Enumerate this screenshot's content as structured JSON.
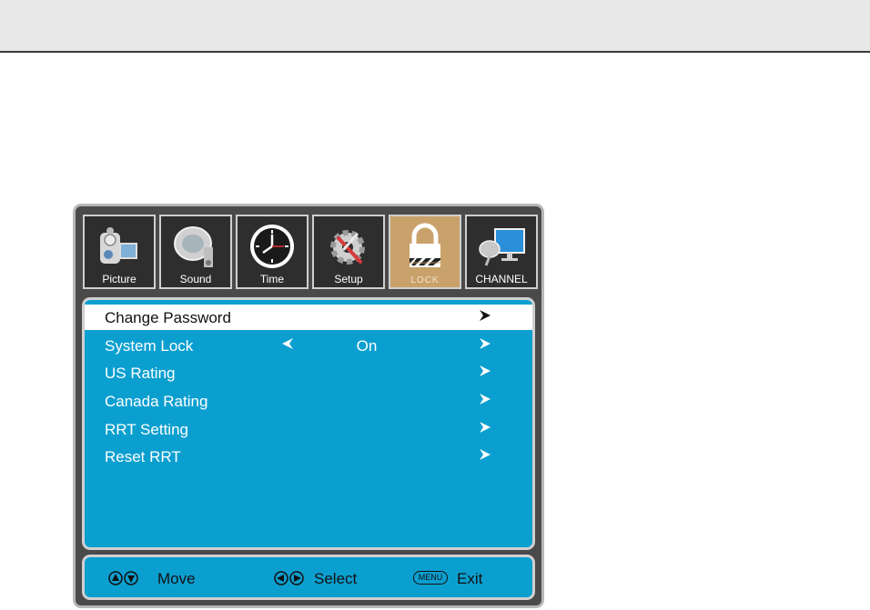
{
  "tabs": [
    {
      "label": "Picture",
      "icon": "camcorder-icon"
    },
    {
      "label": "Sound",
      "icon": "speaker-icon"
    },
    {
      "label": "Time",
      "icon": "clock-icon"
    },
    {
      "label": "Setup",
      "icon": "gear-wrench-icon"
    },
    {
      "label": "LOCK",
      "icon": "padlock-icon",
      "active": true
    },
    {
      "label": "CHANNEL",
      "icon": "satellite-monitor-icon"
    }
  ],
  "menu": {
    "items": [
      {
        "label": "Change Password",
        "value": "",
        "selected": true
      },
      {
        "label": "System Lock",
        "value": "On"
      },
      {
        "label": "US Rating",
        "value": ""
      },
      {
        "label": "Canada Rating",
        "value": ""
      },
      {
        "label": "RRT Setting",
        "value": ""
      },
      {
        "label": "Reset RRT",
        "value": ""
      }
    ]
  },
  "hints": {
    "move": "Move",
    "select": "Select",
    "menu_key": "MENU",
    "exit": "Exit"
  },
  "colors": {
    "panel": "#0b9fd0",
    "frame": "#4a4a4a",
    "active_tab": "#c9a16a"
  }
}
